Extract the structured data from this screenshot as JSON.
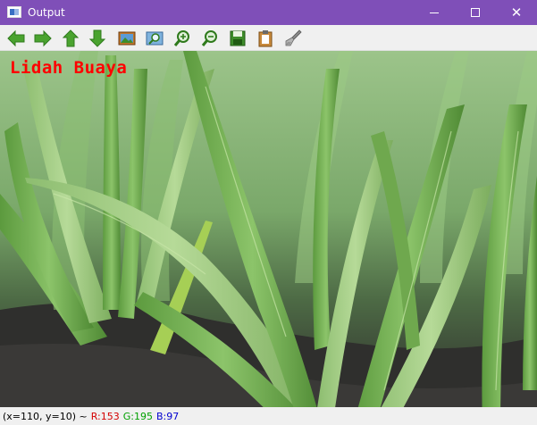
{
  "window": {
    "title": "Output",
    "controls": {
      "minimize": "minimize",
      "maximize": "maximize",
      "close": "✕"
    }
  },
  "toolbar": {
    "buttons": [
      {
        "name": "pan-left",
        "icon": "arrow-left-icon"
      },
      {
        "name": "pan-right",
        "icon": "arrow-right-icon"
      },
      {
        "name": "pan-up",
        "icon": "arrow-up-icon"
      },
      {
        "name": "pan-down",
        "icon": "arrow-down-icon"
      },
      {
        "name": "zoom-original",
        "icon": "image-icon"
      },
      {
        "name": "zoom-fit",
        "icon": "zoom-image-icon"
      },
      {
        "name": "zoom-in",
        "icon": "zoom-in-icon"
      },
      {
        "name": "zoom-out",
        "icon": "zoom-out-icon"
      },
      {
        "name": "save",
        "icon": "floppy-disk-icon"
      },
      {
        "name": "copy",
        "icon": "clipboard-icon"
      },
      {
        "name": "properties",
        "icon": "brush-icon"
      }
    ]
  },
  "image": {
    "overlay_text": "Lidah Buaya",
    "overlay_color": "#ff0000"
  },
  "status": {
    "coords": "(x=110, y=10) ~",
    "r": "R:153",
    "g": "G:195",
    "b": "B:97",
    "colors": {
      "r": "#d40000",
      "g": "#00a000",
      "b": "#0000d0"
    }
  },
  "colors": {
    "titlebar": "#7f4fb8",
    "toolbar_icon_green": "#4aa32f"
  }
}
